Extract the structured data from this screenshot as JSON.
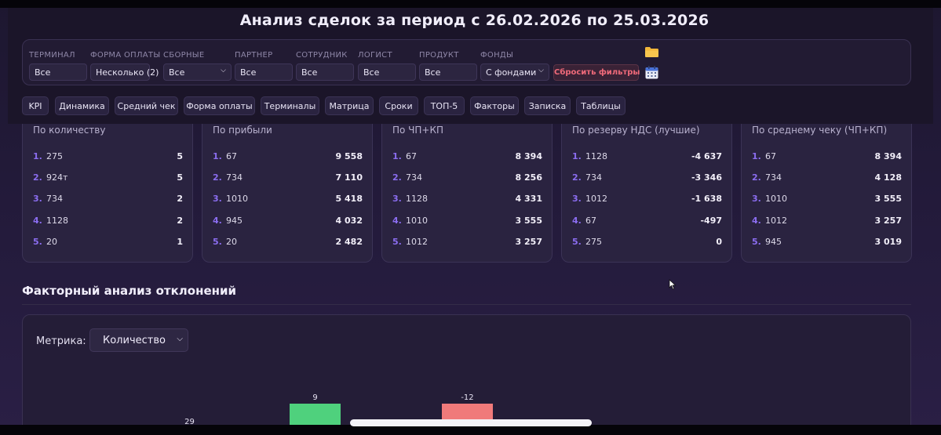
{
  "header": {
    "title": "Анализ сделок за период с 26.02.2026 по 25.03.2026"
  },
  "filters": {
    "fields": [
      {
        "label": "ТЕРМИНАЛ",
        "value": "Все",
        "type": "input"
      },
      {
        "label": "ФОРМА ОПЛАТЫ",
        "value": "Несколько (2)",
        "type": "input"
      },
      {
        "label": "СБОРНЫЕ",
        "value": "Все",
        "type": "select"
      },
      {
        "label": "ПАРТНЕР",
        "value": "Все",
        "type": "input"
      },
      {
        "label": "СОТРУДНИК",
        "value": "Все",
        "type": "input"
      },
      {
        "label": "ЛОГИСТ",
        "value": "Все",
        "type": "input"
      },
      {
        "label": "ПРОДУКТ",
        "value": "Все",
        "type": "input"
      },
      {
        "label": "ФОНДЫ",
        "value": "С фондами",
        "type": "select"
      }
    ],
    "reset_label": "Сбросить фильтры",
    "folder_icon": "folder-icon",
    "calendar_icon": "calendar-icon"
  },
  "tabs": [
    "KPI",
    "Динамика",
    "Средний чек",
    "Форма оплаты",
    "Терминалы",
    "Матрица",
    "Сроки",
    "ТОП-5",
    "Факторы",
    "Записка",
    "Таблицы"
  ],
  "top_cards": [
    {
      "title": "По количеству",
      "rows": [
        {
          "rank": "1.",
          "name": "275",
          "value": "5"
        },
        {
          "rank": "2.",
          "name": "924т",
          "value": "5"
        },
        {
          "rank": "3.",
          "name": "734",
          "value": "2"
        },
        {
          "rank": "4.",
          "name": "1128",
          "value": "2"
        },
        {
          "rank": "5.",
          "name": "20",
          "value": "1"
        }
      ]
    },
    {
      "title": "По прибыли",
      "rows": [
        {
          "rank": "1.",
          "name": "67",
          "value": "9 558"
        },
        {
          "rank": "2.",
          "name": "734",
          "value": "7 110"
        },
        {
          "rank": "3.",
          "name": "1010",
          "value": "5 418"
        },
        {
          "rank": "4.",
          "name": "945",
          "value": "4 032"
        },
        {
          "rank": "5.",
          "name": "20",
          "value": "2 482"
        }
      ]
    },
    {
      "title": "По ЧП+КП",
      "rows": [
        {
          "rank": "1.",
          "name": "67",
          "value": "8 394"
        },
        {
          "rank": "2.",
          "name": "734",
          "value": "8 256"
        },
        {
          "rank": "3.",
          "name": "1128",
          "value": "4 331"
        },
        {
          "rank": "4.",
          "name": "1010",
          "value": "3 555"
        },
        {
          "rank": "5.",
          "name": "1012",
          "value": "3 257"
        }
      ]
    },
    {
      "title": "По резерву НДС (лучшие)",
      "rows": [
        {
          "rank": "1.",
          "name": "1128",
          "value": "-4 637"
        },
        {
          "rank": "2.",
          "name": "734",
          "value": "-3 346"
        },
        {
          "rank": "3.",
          "name": "1012",
          "value": "-1 638"
        },
        {
          "rank": "4.",
          "name": "67",
          "value": "-497"
        },
        {
          "rank": "5.",
          "name": "275",
          "value": "0"
        }
      ]
    },
    {
      "title": "По среднему чеку (ЧП+КП)",
      "rows": [
        {
          "rank": "1.",
          "name": "67",
          "value": "8 394"
        },
        {
          "rank": "2.",
          "name": "734",
          "value": "4 128"
        },
        {
          "rank": "3.",
          "name": "1010",
          "value": "3 555"
        },
        {
          "rank": "4.",
          "name": "1012",
          "value": "3 257"
        },
        {
          "rank": "5.",
          "name": "945",
          "value": "3 019"
        }
      ]
    }
  ],
  "factor_section": {
    "title": "Факторный анализ отклонений",
    "metric_label": "Метрика:",
    "metric_value": "Количество",
    "metric_chevron_icon": "chevron-down-icon"
  },
  "chart_data": {
    "type": "bar",
    "categories": [
      "",
      "",
      ""
    ],
    "values": [
      29,
      9,
      -12
    ],
    "title": "",
    "xlabel": "",
    "ylabel": "",
    "colors": [
      "#8a7fb0",
      "#4fd17d",
      "#f07a7a"
    ]
  },
  "colors": {
    "accent": "#8b6df0",
    "positive": "#4fd17d",
    "negative": "#f07a7a",
    "reset": "#f06a7a"
  }
}
